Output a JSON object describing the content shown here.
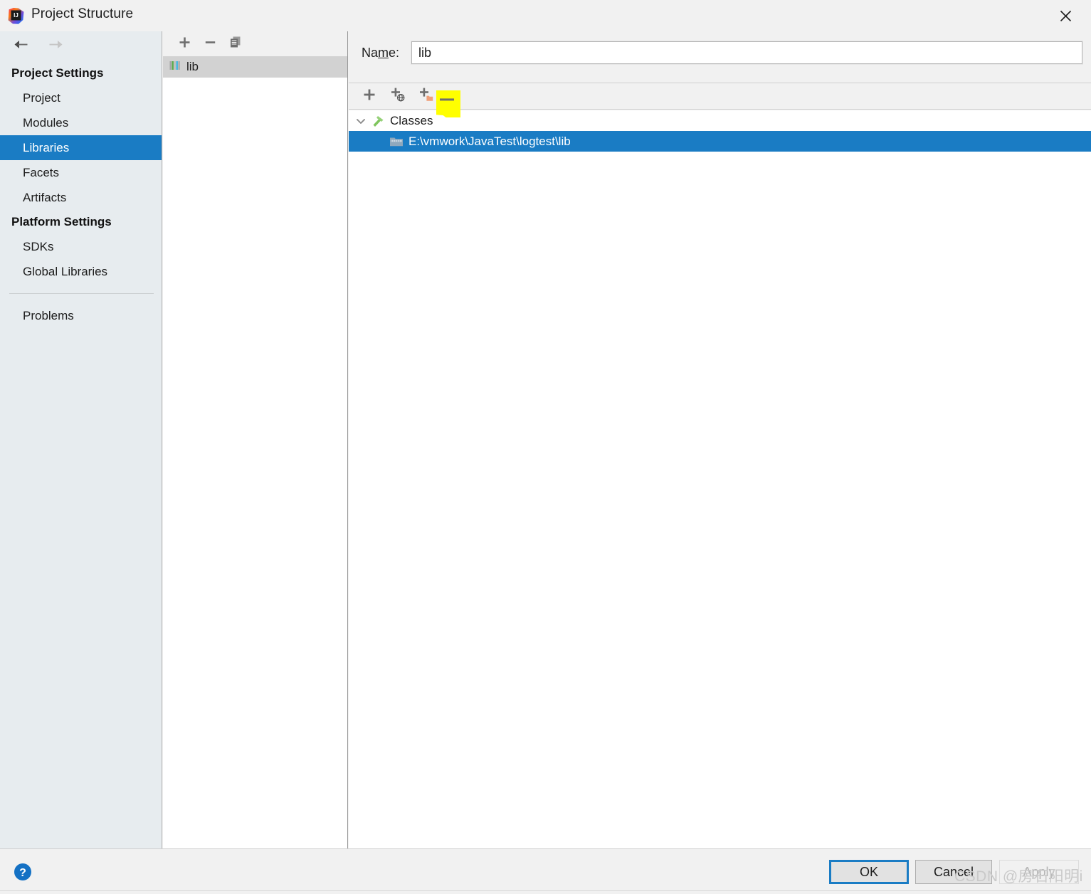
{
  "window": {
    "title": "Project Structure",
    "logo_icon": "intellij-idea-logo",
    "close_icon": "close-icon"
  },
  "sidebar": {
    "back_icon": "arrow-left-icon",
    "forward_icon": "arrow-right-icon",
    "groups": [
      {
        "label": "Project Settings",
        "items": [
          {
            "label": "Project",
            "selected": false
          },
          {
            "label": "Modules",
            "selected": false
          },
          {
            "label": "Libraries",
            "selected": true
          },
          {
            "label": "Facets",
            "selected": false
          },
          {
            "label": "Artifacts",
            "selected": false
          }
        ]
      },
      {
        "label": "Platform Settings",
        "items": [
          {
            "label": "SDKs",
            "selected": false
          },
          {
            "label": "Global Libraries",
            "selected": false
          }
        ]
      }
    ],
    "problems": {
      "label": "Problems"
    }
  },
  "libraries_panel": {
    "toolbar": [
      {
        "name": "add-library-button",
        "icon": "plus-icon"
      },
      {
        "name": "remove-library-button",
        "icon": "minus-icon"
      },
      {
        "name": "copy-library-button",
        "icon": "copy-icon"
      }
    ],
    "items": [
      {
        "label": "lib",
        "icon": "library-icon",
        "selected": true
      }
    ]
  },
  "details": {
    "name_label_prefix": "Na",
    "name_label_mnemonic": "m",
    "name_label_suffix": "e:",
    "name_value": "lib",
    "name_placeholder": "",
    "roots_toolbar": [
      {
        "name": "add-root-button",
        "icon": "plus-icon"
      },
      {
        "name": "add-remote-root-button",
        "icon": "plus-globe-icon"
      },
      {
        "name": "add-excluded-root-button",
        "icon": "plus-folder-icon"
      },
      {
        "name": "remove-root-button",
        "icon": "minus-icon"
      }
    ],
    "tree": {
      "root": {
        "label": "Classes",
        "icon": "classes-hammer-icon",
        "chevron": "chevron-down-icon",
        "expanded": true
      },
      "children": [
        {
          "label": "E:\\vmwork\\JavaTest\\logtest\\lib",
          "icon": "archive-folder-icon",
          "selected": true
        }
      ]
    }
  },
  "footer": {
    "help_icon": "help-question-icon",
    "ok_label": "OK",
    "cancel_label": "Cancel",
    "apply_label": "Apply",
    "apply_disabled": true
  },
  "overlay": {
    "highlight_color": "#ffff00",
    "watermark": "CSDN @房石阳明i"
  },
  "colors": {
    "selection_blue": "#1a7cc4",
    "dialog_bg": "#f1f1f1",
    "sidebar_bg": "#e7ecef",
    "panel_bg": "#ffffff"
  }
}
